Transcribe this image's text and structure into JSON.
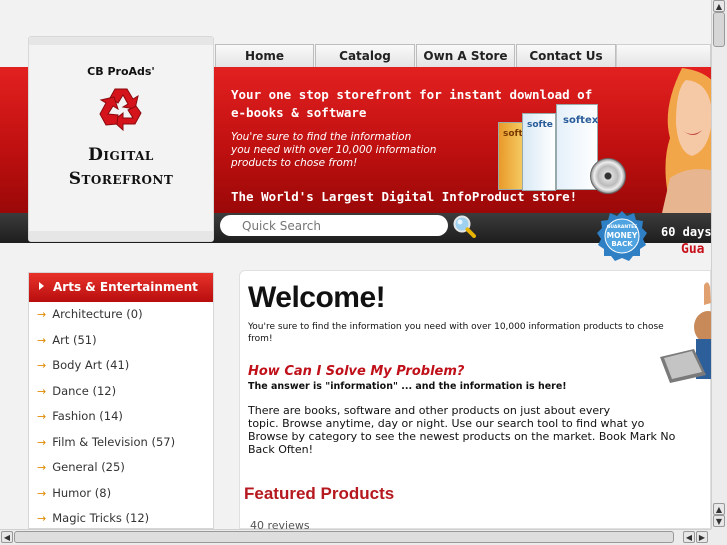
{
  "brand": {
    "top": "CB ProAds'",
    "line1": "Digital",
    "line2": "Storefront"
  },
  "nav": {
    "items": [
      {
        "label": "Home"
      },
      {
        "label": "Catalog"
      },
      {
        "label": "Own A Store"
      },
      {
        "label": "Contact Us"
      }
    ]
  },
  "banner": {
    "tagline_1": "Your one stop storefront for instant download of",
    "tagline_2": "e-books & software",
    "sub_1": "You're sure to find the information",
    "sub_2": "you need with over 10,000 information",
    "sub_3": "products to chose from!",
    "big": "The World's Largest Digital InfoProduct store!",
    "box_1": "soft",
    "box_2": "softe",
    "box_3": "softex"
  },
  "search": {
    "placeholder": "Quick Search"
  },
  "guarantee": {
    "badge_top": "GUARANTEE",
    "badge_mid": "MONEY",
    "badge_bot": "BACK",
    "days_text": "60 days",
    "guar_text": "Gua"
  },
  "sidebar": {
    "heading": "Arts & Entertainment",
    "items": [
      {
        "label": "Architecture (0)"
      },
      {
        "label": "Art (51)"
      },
      {
        "label": "Body Art (41)"
      },
      {
        "label": "Dance (12)"
      },
      {
        "label": "Fashion (14)"
      },
      {
        "label": "Film & Television (57)"
      },
      {
        "label": "General (25)"
      },
      {
        "label": "Humor (8)"
      },
      {
        "label": "Magic Tricks (12)"
      }
    ]
  },
  "content": {
    "welcome": "Welcome!",
    "welcome_desc": "You're sure to find the information you need with over 10,000 information products to chose from!",
    "heading": "How Can I Solve My Problem?",
    "heading_sub": "The answer is \"information\" ... and the information is here!",
    "body_1": "There are books, software and other products on just about every",
    "body_2": "topic. Browse anytime, day or night. Use our search tool to find what yo",
    "body_3": "Browse by category to see the newest products on the market. Book Mark No",
    "body_4": "Back Often!",
    "featured": "Featured Products",
    "reviews": "40 reviews"
  },
  "colors": {
    "banner_red": "#c01010",
    "heading_red": "#b5181e",
    "arrow_orange": "#e08a00"
  }
}
